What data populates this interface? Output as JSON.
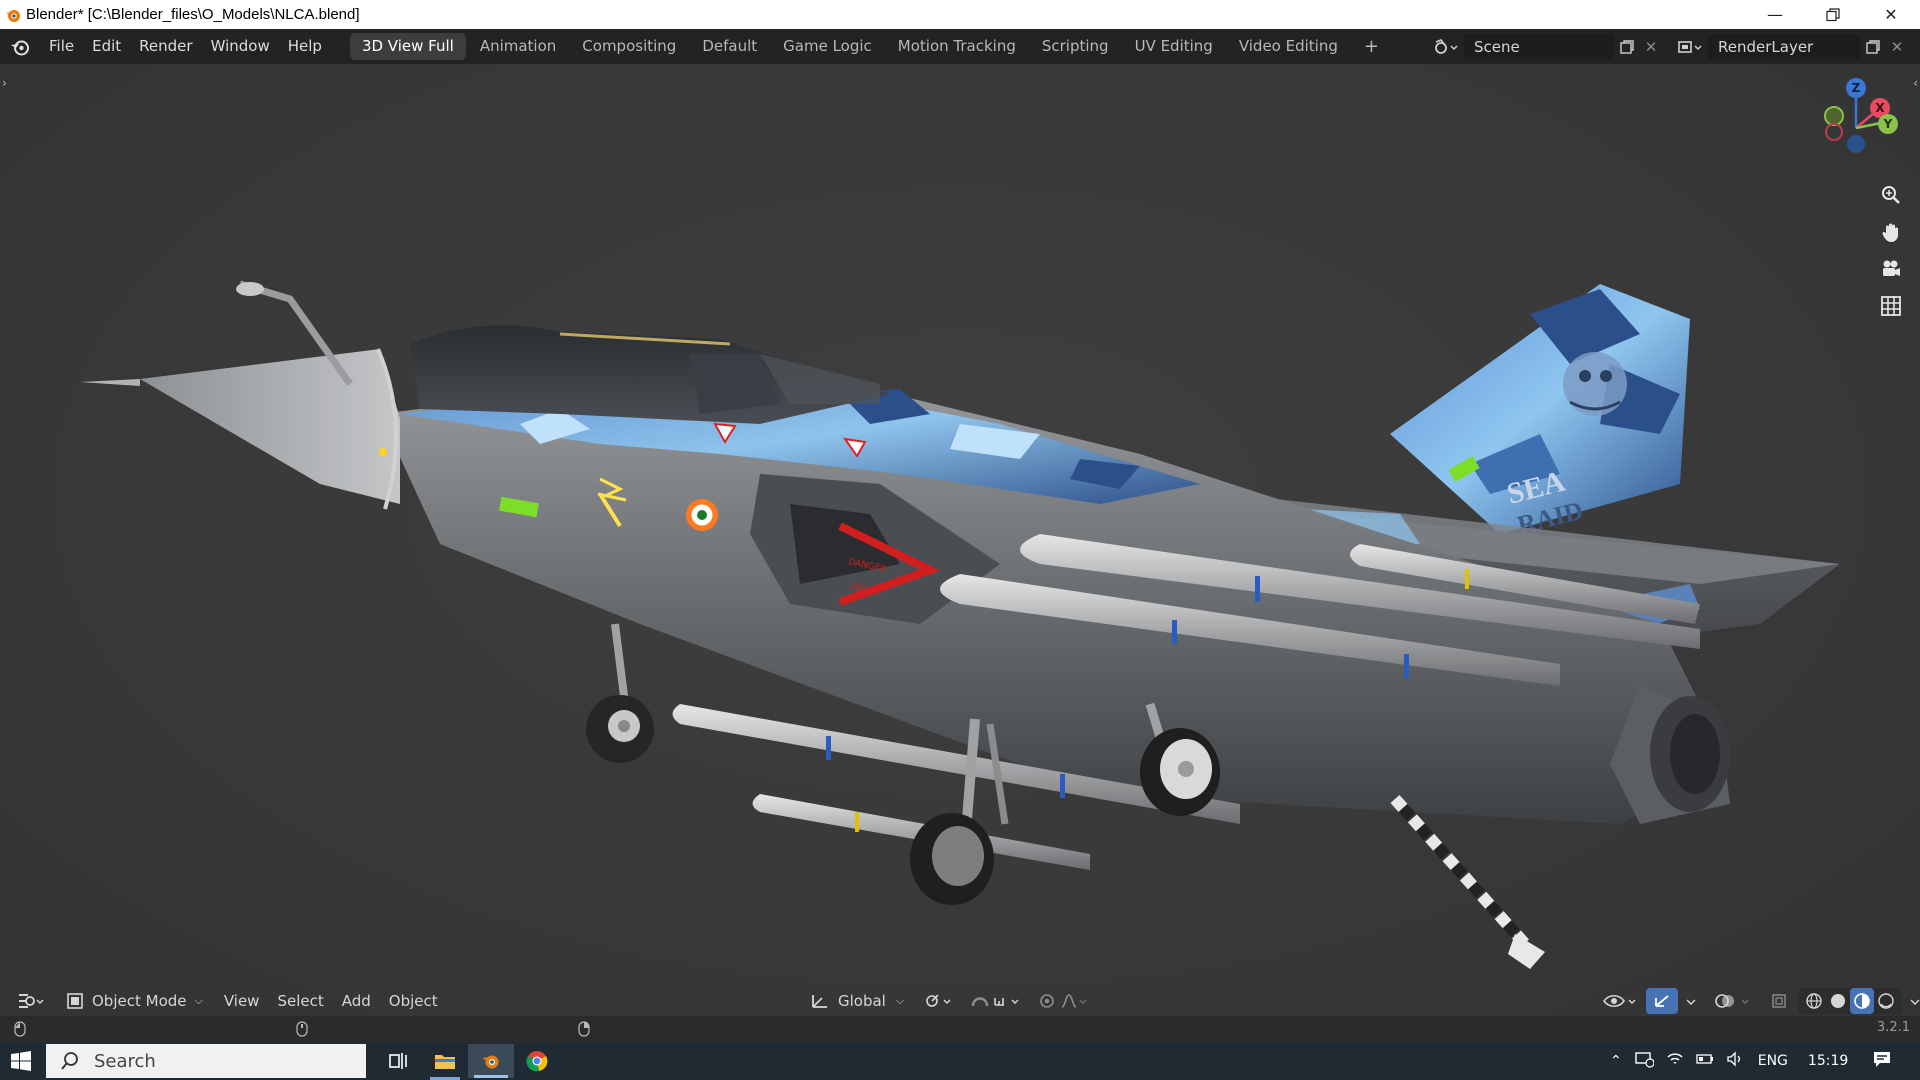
{
  "window": {
    "title": "Blender* [C:\\Blender_files\\O_Models\\NLCA.blend]",
    "controls": [
      "minimize-icon",
      "restore-icon",
      "close-icon"
    ]
  },
  "menus": [
    "File",
    "Edit",
    "Render",
    "Window",
    "Help"
  ],
  "workspaces": [
    {
      "label": "3D View Full",
      "active": true
    },
    {
      "label": "Animation",
      "active": false
    },
    {
      "label": "Compositing",
      "active": false
    },
    {
      "label": "Default",
      "active": false
    },
    {
      "label": "Game Logic",
      "active": false
    },
    {
      "label": "Motion Tracking",
      "active": false
    },
    {
      "label": "Scripting",
      "active": false
    },
    {
      "label": "UV Editing",
      "active": false
    },
    {
      "label": "Video Editing",
      "active": false
    }
  ],
  "add_workspace": "+",
  "scene": {
    "value": "Scene"
  },
  "view_layer": {
    "value": "RenderLayer"
  },
  "gizmo": {
    "z": "Z",
    "x": "X",
    "y": "Y"
  },
  "header": {
    "mode": "Object Mode",
    "menus": [
      "View",
      "Select",
      "Add",
      "Object"
    ],
    "orientation": "Global"
  },
  "model": {
    "tail_text_1": "SEA",
    "tail_text_2": "RAID",
    "intake_text_1": "DANGER",
    "intake_text_2": "INTAKE"
  },
  "version": "3.2.1",
  "taskbar": {
    "search_placeholder": "Search",
    "language": "ENG",
    "time": "15:19"
  },
  "colors": {
    "accent": "#4772b3",
    "camo_light": "#8ec6f0",
    "camo_dark": "#2b4f8a",
    "fuselage": "#707376"
  }
}
